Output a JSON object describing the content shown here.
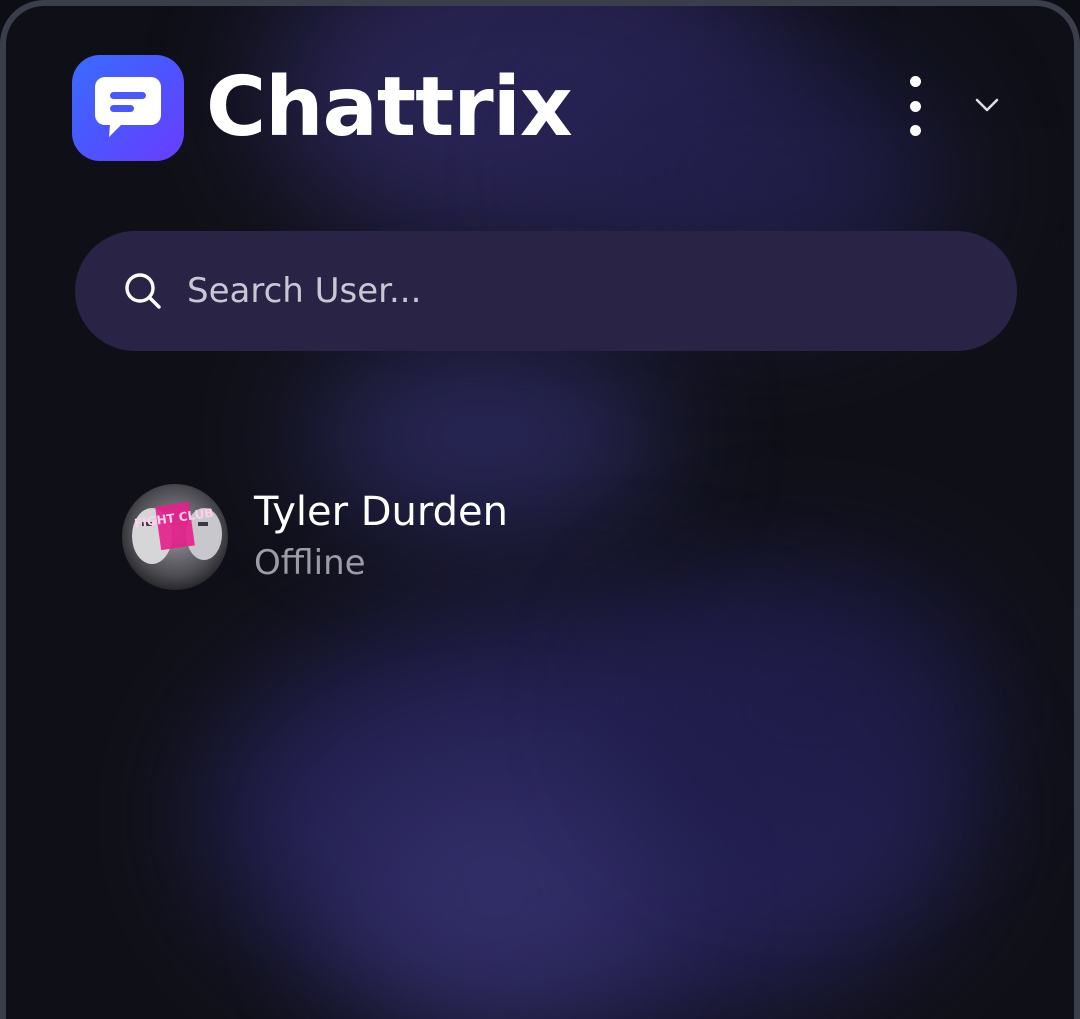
{
  "app": {
    "title": "Chattrix",
    "logo_icon": "chat-bubble-icon",
    "accent": "#4a57ff"
  },
  "header": {
    "menu_icon": "more-vertical-icon",
    "expand_icon": "chevron-down-icon"
  },
  "search": {
    "placeholder": "Search User...",
    "value": "",
    "icon": "search-icon"
  },
  "users": [
    {
      "name": "Tyler Durden",
      "status": "Offline",
      "avatar_text": "FIGHT CLUB",
      "status_color": "#9c9ba8"
    }
  ]
}
